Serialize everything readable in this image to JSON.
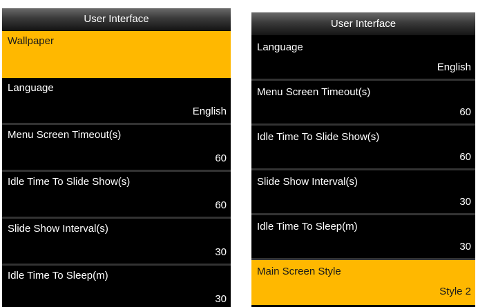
{
  "left_screen": {
    "title": "User Interface",
    "items": [
      {
        "label": "Wallpaper",
        "value": "",
        "selected": true
      },
      {
        "label": "Language",
        "value": "English",
        "selected": false
      },
      {
        "label": "Menu Screen Timeout(s)",
        "value": "60",
        "selected": false
      },
      {
        "label": "Idle Time To Slide Show(s)",
        "value": "60",
        "selected": false
      },
      {
        "label": "Slide Show Interval(s)",
        "value": "30",
        "selected": false
      },
      {
        "label": "Idle Time To Sleep(m)",
        "value": "30",
        "selected": false
      }
    ]
  },
  "right_screen": {
    "title": "User Interface",
    "items": [
      {
        "label": "Language",
        "value": "English",
        "selected": false
      },
      {
        "label": "Menu Screen Timeout(s)",
        "value": "60",
        "selected": false
      },
      {
        "label": "Idle Time To Slide Show(s)",
        "value": "60",
        "selected": false
      },
      {
        "label": "Slide Show Interval(s)",
        "value": "30",
        "selected": false
      },
      {
        "label": "Idle Time To Sleep(m)",
        "value": "30",
        "selected": false
      },
      {
        "label": "Main Screen Style",
        "value": "Style 2",
        "selected": true
      }
    ]
  },
  "colors": {
    "highlight": "#ffb800",
    "background": "#000000",
    "text": "#ffffff"
  }
}
